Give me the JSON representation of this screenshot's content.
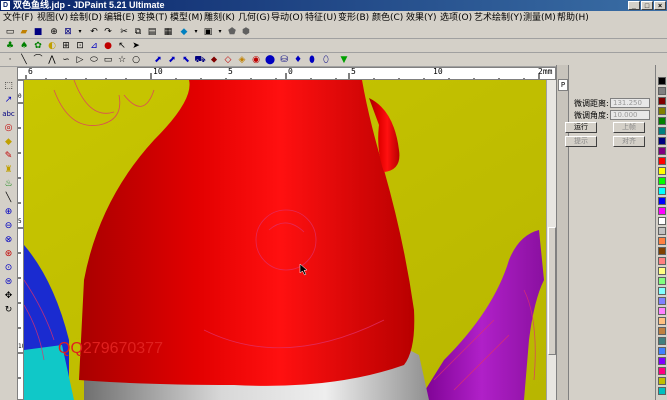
{
  "window": {
    "title": "双色鱼线.jdp - JDPaint 5.21 Ultimate",
    "controls": [
      "_",
      "□",
      "×"
    ]
  },
  "menus": [
    "文件(F)",
    "视图(V)",
    "绘制(D)",
    "编辑(E)",
    "变换(T)",
    "模型(M)",
    "雕刻(K)",
    "几何(G)",
    "导动(O)",
    "特征(U)",
    "变形(B)",
    "颜色(C)",
    "效果(Y)",
    "选项(O)",
    "艺术绘制(Y)",
    "测量(M)",
    "帮助(H)"
  ],
  "ruler": {
    "h_labels": [
      "6",
      "10",
      "5",
      "0",
      "5",
      "10",
      "2mm"
    ],
    "v_labels": [
      "0",
      "5",
      "10"
    ]
  },
  "panel": {
    "tab_label": "P",
    "field1_label": "微调距离:",
    "field1_value": "131.250",
    "field2_label": "微调角度:",
    "field2_value": "10.000",
    "buttons": [
      "运行",
      "上帧",
      "提示",
      "对齐"
    ]
  },
  "watermark": "QQ279670377",
  "colors": {
    "background": "#c6c400",
    "fish_head": "#e00000",
    "fin": "#9a10b0",
    "white_body": "#d8d8d8",
    "blue_shape": "#1a2bd0",
    "cyan_shape": "#10c8c8"
  },
  "palette": [
    "#000000",
    "#808080",
    "#800000",
    "#808000",
    "#008000",
    "#008080",
    "#000080",
    "#800080",
    "#ff0000",
    "#ffff00",
    "#00ff00",
    "#00ffff",
    "#0000ff",
    "#ff00ff",
    "#ffffff",
    "#c0c0c0",
    "#ff8040",
    "#804000",
    "#ff8080",
    "#ffff80",
    "#80ff80",
    "#80ffff",
    "#8080ff",
    "#ff80ff",
    "#ffc080",
    "#c08040",
    "#408080",
    "#4080ff",
    "#8000ff",
    "#ff0080",
    "#c0c000",
    "#00c0c0"
  ]
}
